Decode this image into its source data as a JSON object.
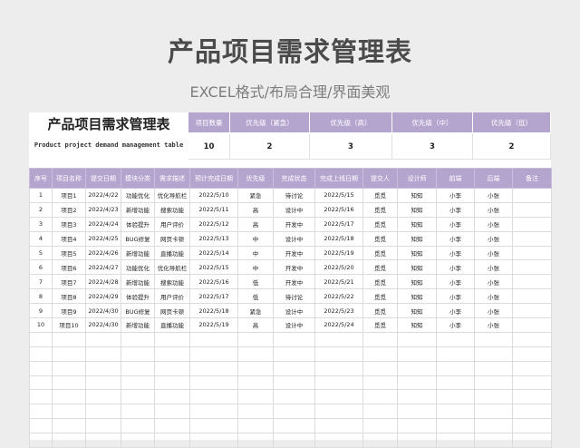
{
  "page": {
    "title": "产品项目需求管理表",
    "subtitle": "EXCEL格式/布局合理/界面美观"
  },
  "summary": {
    "title": "产品项目需求管理表",
    "subtitle": "Product project demand management table",
    "headers": [
      "项目数量",
      "优先级（紧急）",
      "优先级（高）",
      "优先级（中）",
      "优先级（低）"
    ],
    "values": [
      "10",
      "2",
      "3",
      "3",
      "2"
    ]
  },
  "table": {
    "columns": [
      "序号",
      "项目名称",
      "提交日期",
      "模块分类",
      "需求描述",
      "预计完成日期",
      "优先级",
      "完成状态",
      "完成上线日期",
      "提交人",
      "设计师",
      "前端",
      "后端",
      "备注"
    ],
    "rows": [
      [
        "1",
        "项目1",
        "2022/4/22",
        "功能优化",
        "优化导航栏",
        "2022/5/10",
        "紧急",
        "待讨论",
        "2022/5/15",
        "觅觅",
        "知知",
        "小李",
        "小张",
        ""
      ],
      [
        "2",
        "项目2",
        "2022/4/23",
        "新增功能",
        "搜索功能",
        "2022/5/11",
        "高",
        "设计中",
        "2022/5/16",
        "觅觅",
        "知知",
        "小李",
        "小张",
        ""
      ],
      [
        "3",
        "项目3",
        "2022/4/24",
        "体验提升",
        "用户评价",
        "2022/5/12",
        "高",
        "开发中",
        "2022/5/17",
        "觅觅",
        "知知",
        "小李",
        "小张",
        ""
      ],
      [
        "4",
        "项目4",
        "2022/4/25",
        "BUG修复",
        "网页卡顿",
        "2022/5/13",
        "中",
        "设计中",
        "2022/5/18",
        "觅觅",
        "知知",
        "小李",
        "小张",
        ""
      ],
      [
        "5",
        "项目5",
        "2022/4/26",
        "新增功能",
        "直播功能",
        "2022/5/14",
        "中",
        "开发中",
        "2022/5/19",
        "觅觅",
        "知知",
        "小李",
        "小张",
        ""
      ],
      [
        "6",
        "项目6",
        "2022/4/27",
        "功能优化",
        "优化导航栏",
        "2022/5/15",
        "中",
        "开发中",
        "2022/5/20",
        "觅觅",
        "知知",
        "小李",
        "小张",
        ""
      ],
      [
        "7",
        "项目7",
        "2022/4/28",
        "新增功能",
        "搜索功能",
        "2022/5/16",
        "低",
        "开发中",
        "2022/5/21",
        "觅觅",
        "知知",
        "小李",
        "小张",
        ""
      ],
      [
        "8",
        "项目8",
        "2022/4/29",
        "体验提升",
        "用户评价",
        "2022/5/17",
        "低",
        "待讨论",
        "2022/5/22",
        "觅觅",
        "知知",
        "小李",
        "小张",
        ""
      ],
      [
        "9",
        "项目9",
        "2022/4/30",
        "BUG修复",
        "网页卡顿",
        "2022/5/18",
        "紧急",
        "设计中",
        "2022/5/23",
        "觅觅",
        "知知",
        "小李",
        "小张",
        ""
      ],
      [
        "10",
        "项目10",
        "2022/4/30",
        "新增功能",
        "直播功能",
        "2022/5/19",
        "高",
        "设计中",
        "2022/5/24",
        "觅觅",
        "知知",
        "小李",
        "小张",
        ""
      ],
      [
        "",
        "",
        "",
        "",
        "",
        "",
        "",
        "",
        "",
        "",
        "",
        "",
        "",
        ""
      ],
      [
        "",
        "",
        "",
        "",
        "",
        "",
        "",
        "",
        "",
        "",
        "",
        "",
        "",
        ""
      ],
      [
        "",
        "",
        "",
        "",
        "",
        "",
        "",
        "",
        "",
        "",
        "",
        "",
        "",
        ""
      ],
      [
        "",
        "",
        "",
        "",
        "",
        "",
        "",
        "",
        "",
        "",
        "",
        "",
        "",
        ""
      ],
      [
        "",
        "",
        "",
        "",
        "",
        "",
        "",
        "",
        "",
        "",
        "",
        "",
        "",
        ""
      ],
      [
        "",
        "",
        "",
        "",
        "",
        "",
        "",
        "",
        "",
        "",
        "",
        "",
        "",
        ""
      ],
      [
        "",
        "",
        "",
        "",
        "",
        "",
        "",
        "",
        "",
        "",
        "",
        "",
        "",
        ""
      ],
      [
        "",
        "",
        "",
        "",
        "",
        "",
        "",
        "",
        "",
        "",
        "",
        "",
        "",
        ""
      ]
    ]
  },
  "colors": {
    "header_purple": "#b4a5cf",
    "background": "#ededed"
  }
}
